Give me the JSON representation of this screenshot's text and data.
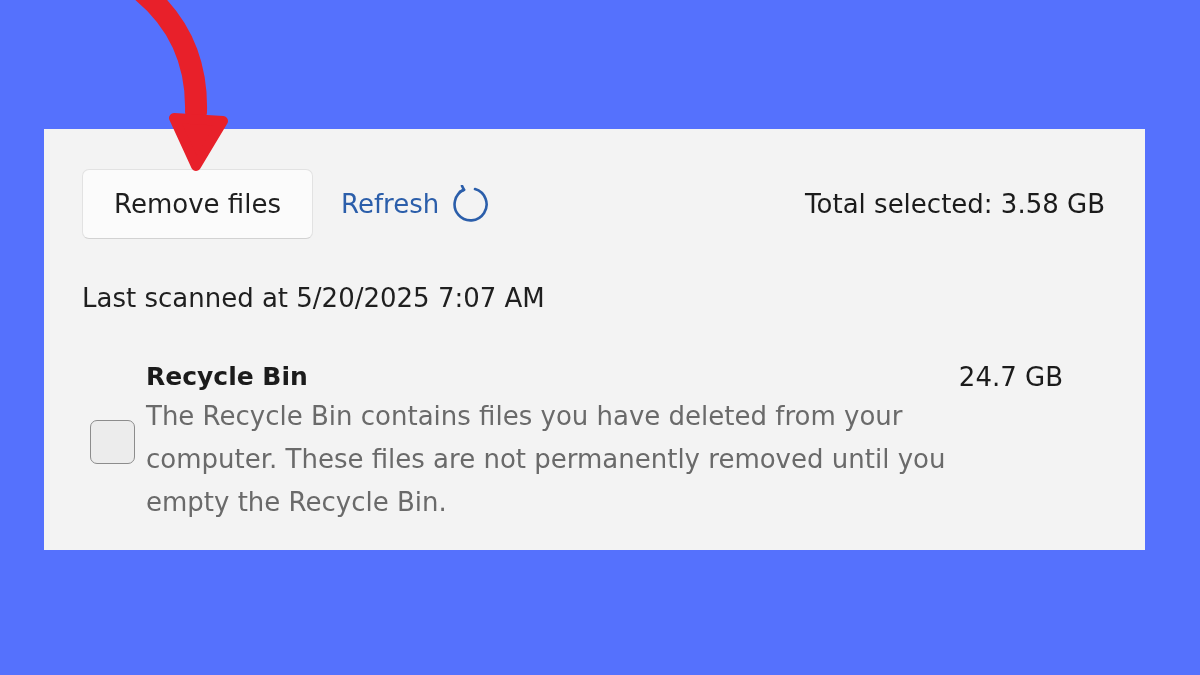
{
  "annotations": [
    {
      "kind": "arrow"
    }
  ],
  "toolbar": {
    "remove_button": "Remove files",
    "refresh_link": "Refresh",
    "total_selected": "Total selected: 3.58 GB"
  },
  "last_scanned": "Last scanned at 5/20/2025 7:07 AM",
  "items": [
    {
      "title": "Recycle Bin",
      "size": "24.7 GB",
      "description": "The Recycle Bin contains files you have deleted from your computer. These files are not permanently removed until you empty the Recycle Bin.",
      "checked": false
    }
  ]
}
